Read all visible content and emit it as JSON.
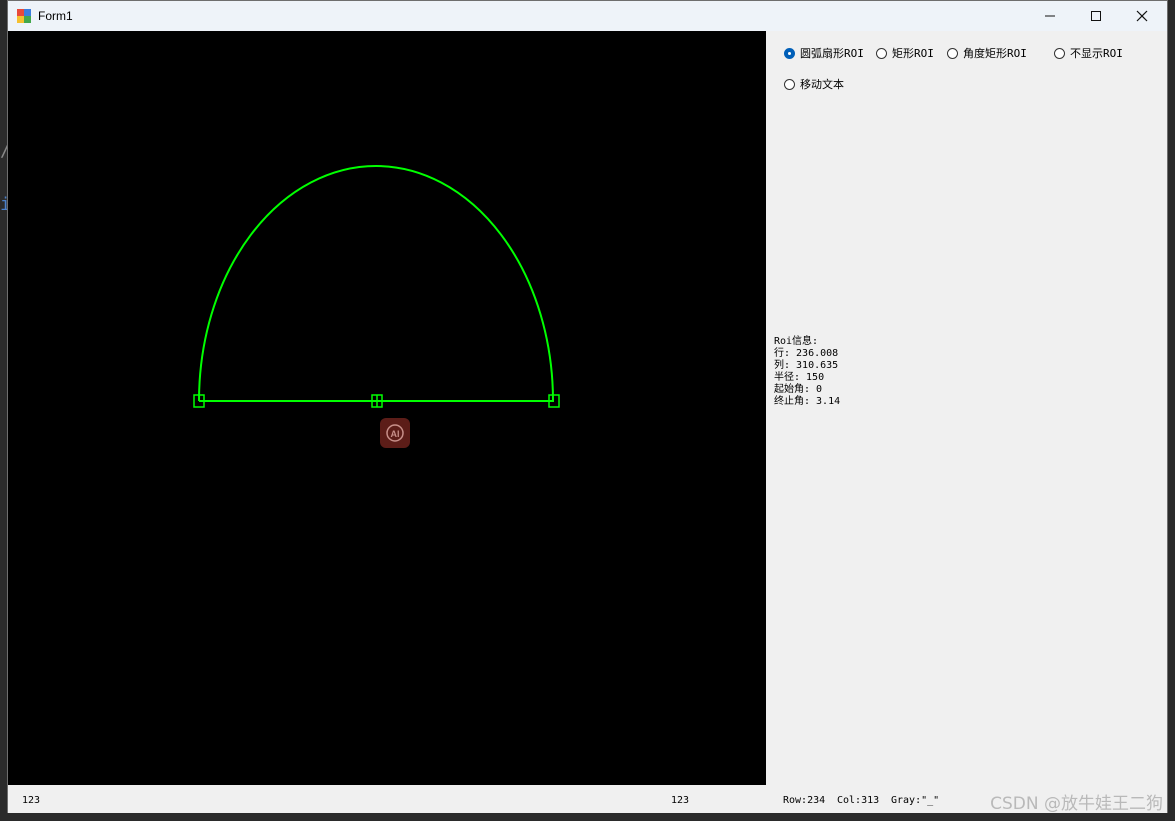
{
  "window": {
    "title": "Form1"
  },
  "title_controls": {
    "minimize": "minimize-icon",
    "maximize": "maximize-icon",
    "close": "close-icon"
  },
  "background_glyphs": [
    "/",
    "i"
  ],
  "options": [
    {
      "label": "圆弧扇形ROI",
      "checked": true
    },
    {
      "label": "矩形ROI",
      "checked": false
    },
    {
      "label": "角度矩形ROI",
      "checked": false
    },
    {
      "label": "不显示ROI",
      "checked": false
    },
    {
      "label": "移动文本",
      "checked": false
    }
  ],
  "roi_info": {
    "heading": "Roi信息:",
    "lines": [
      "行: 236.008",
      "列: 310.635",
      "半径: 150",
      "起始角: 0",
      "终止角: 3.14"
    ]
  },
  "status": {
    "left": "123",
    "middle": "123",
    "row": "Row:234",
    "col": "Col:313",
    "gray": "Gray:\"_\""
  },
  "watermark": "CSDN @放牛娃王二狗",
  "colors": {
    "roi": "#00ff00",
    "canvas": "#000000",
    "accent": "#005fb8"
  },
  "ai_badge_icon": "ai-icon"
}
